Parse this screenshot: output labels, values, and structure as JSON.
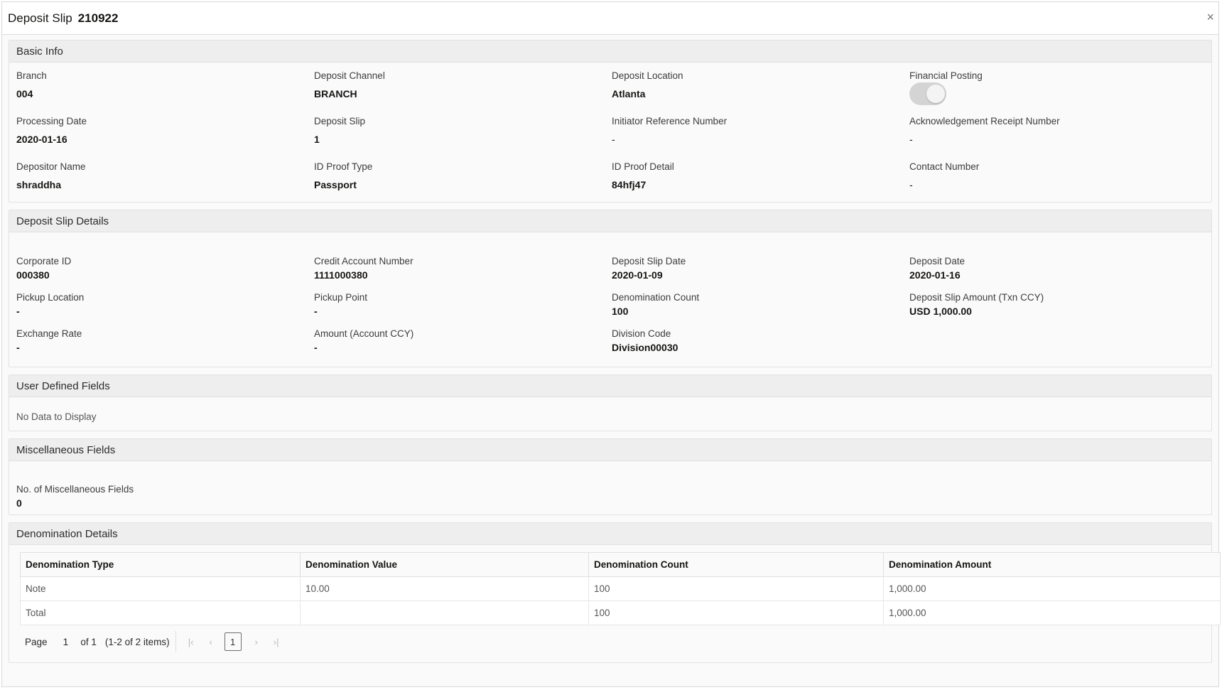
{
  "dialog": {
    "title": "Deposit Slip",
    "slip_number": "210922",
    "close_icon": "×"
  },
  "basic_info": {
    "heading": "Basic Info",
    "fields": [
      {
        "label": "Branch",
        "value": "004"
      },
      {
        "label": "Deposit Channel",
        "value": "BRANCH"
      },
      {
        "label": "Deposit Location",
        "value": "Atlanta"
      },
      {
        "label": "Financial Posting",
        "toggle": "off"
      },
      {
        "label": "Processing Date",
        "value": "2020-01-16"
      },
      {
        "label": "Deposit Slip",
        "value": "1"
      },
      {
        "label": "Initiator Reference Number",
        "value": "-"
      },
      {
        "label": "Acknowledgement Receipt Number",
        "value": "-"
      },
      {
        "label": "Depositor Name",
        "value": "shraddha"
      },
      {
        "label": "ID Proof Type",
        "value": "Passport"
      },
      {
        "label": "ID Proof Detail",
        "value": "84hfj47"
      },
      {
        "label": "Contact Number",
        "value": "-"
      }
    ]
  },
  "deposit_slip_details": {
    "heading": "Deposit Slip Details",
    "fields": [
      {
        "label": "Corporate ID",
        "value": "000380"
      },
      {
        "label": "Credit Account Number",
        "value": "1111000380"
      },
      {
        "label": "Deposit Slip Date",
        "value": "2020-01-09"
      },
      {
        "label": "Deposit Date",
        "value": "2020-01-16"
      },
      {
        "label": "Pickup Location",
        "value": "-"
      },
      {
        "label": "Pickup Point",
        "value": "-"
      },
      {
        "label": "Denomination Count",
        "value": "100"
      },
      {
        "label": "Deposit Slip Amount (Txn CCY)",
        "value": "USD 1,000.00"
      },
      {
        "label": "Exchange Rate",
        "value": "-"
      },
      {
        "label": "Amount (Account CCY)",
        "value": "-"
      },
      {
        "label": "Division Code",
        "value": "Division00030"
      }
    ]
  },
  "user_defined_fields": {
    "heading": "User Defined Fields",
    "empty_text": "No Data to Display"
  },
  "miscellaneous_fields": {
    "heading": "Miscellaneous Fields",
    "label": "No. of Miscellaneous Fields",
    "value": "0"
  },
  "denomination_details": {
    "heading": "Denomination Details",
    "columns": [
      "Denomination Type",
      "Denomination Value",
      "Denomination Count",
      "Denomination Amount"
    ],
    "rows": [
      [
        "Note",
        "10.00",
        "100",
        "1,000.00"
      ],
      [
        "Total",
        "",
        "100",
        "1,000.00"
      ]
    ],
    "pager": {
      "page_label": "Page",
      "page_number": "1",
      "of_label": "of 1",
      "items_label": "(1-2 of 2 items)",
      "current_page": "1",
      "first_icon": "first-page-icon",
      "prev_icon": "previous-page-icon",
      "next_icon": "next-page-icon",
      "last_icon": "last-page-icon"
    }
  }
}
